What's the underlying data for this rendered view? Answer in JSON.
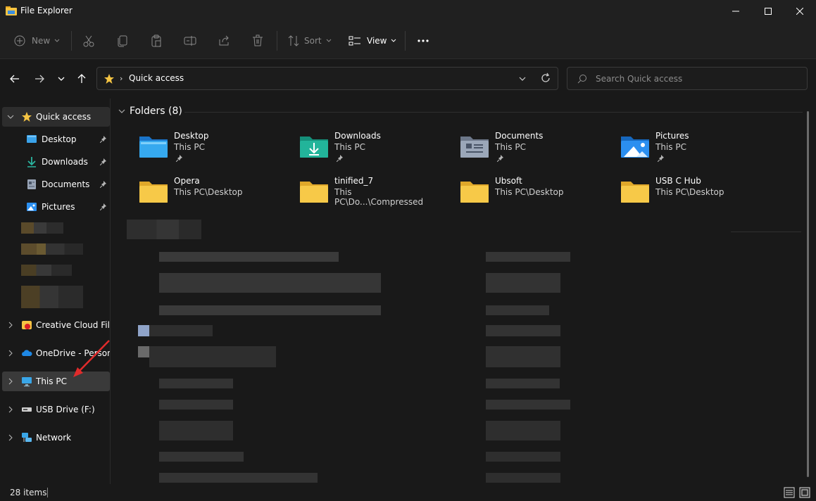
{
  "window": {
    "title": "File Explorer",
    "controls": [
      "minimize",
      "maximize",
      "close"
    ]
  },
  "toolbar": {
    "new_label": "New",
    "sort_label": "Sort",
    "view_label": "View",
    "buttons": [
      "cut",
      "copy",
      "paste",
      "rename",
      "share",
      "delete",
      "more"
    ]
  },
  "address": {
    "location": "Quick access",
    "search_placeholder": "Search Quick access"
  },
  "sidebar": {
    "quick_access": "Quick access",
    "pinned": [
      {
        "label": "Desktop",
        "icon": "desktop-icon"
      },
      {
        "label": "Downloads",
        "icon": "download-icon"
      },
      {
        "label": "Documents",
        "icon": "document-icon"
      },
      {
        "label": "Pictures",
        "icon": "pictures-icon"
      }
    ],
    "roots": [
      {
        "label": "Creative Cloud Files",
        "icon": "creative-cloud-icon"
      },
      {
        "label": "OneDrive - Personal",
        "icon": "onedrive-icon"
      },
      {
        "label": "This PC",
        "icon": "monitor-icon"
      },
      {
        "label": "USB Drive (F:)",
        "icon": "usb-drive-icon"
      },
      {
        "label": "Network",
        "icon": "network-icon"
      }
    ]
  },
  "content": {
    "folders_header": "Folders (8)",
    "folders": [
      {
        "name": "Desktop",
        "path": "This PC",
        "pinned": true,
        "icon": "desktop-folder-icon"
      },
      {
        "name": "Downloads",
        "path": "This PC",
        "pinned": true,
        "icon": "downloads-folder-icon"
      },
      {
        "name": "Documents",
        "path": "This PC",
        "pinned": true,
        "icon": "documents-folder-icon"
      },
      {
        "name": "Pictures",
        "path": "This PC",
        "pinned": true,
        "icon": "pictures-folder-icon"
      },
      {
        "name": "Opera",
        "path": "This PC\\Desktop",
        "pinned": false,
        "icon": "folder-icon"
      },
      {
        "name": "tinified_7",
        "path": "This PC\\Do...\\Compressed",
        "pinned": false,
        "icon": "folder-icon"
      },
      {
        "name": "Ubsoft",
        "path": "This PC\\Desktop",
        "pinned": false,
        "icon": "folder-icon"
      },
      {
        "name": "USB C Hub",
        "path": "This PC\\Desktop",
        "pinned": false,
        "icon": "folder-icon"
      }
    ]
  },
  "status": {
    "items_count": "28 items"
  },
  "colors": {
    "background": "#191919",
    "chrome": "#202020",
    "folder_yellow": "#f5c443",
    "accent_blue": "#2b8ff0",
    "annotation_red": "#e02b2b"
  }
}
